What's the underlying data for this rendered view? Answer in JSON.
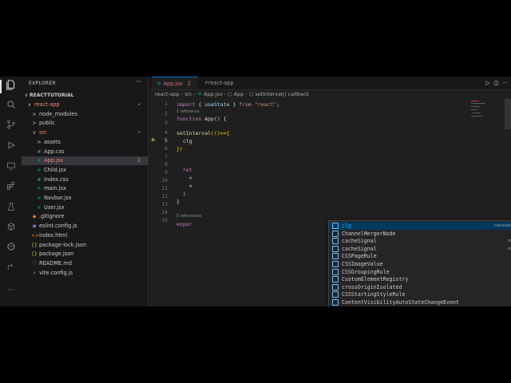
{
  "explorer": {
    "title": "EXPLORER",
    "more": "···",
    "project": "REACTTUTORIAL",
    "rows": [
      {
        "depth": 0,
        "chev": "∨",
        "label": "react-app",
        "badge": "•",
        "color": "#f48771"
      },
      {
        "depth": 1,
        "chev": ">",
        "label": "node_modules",
        "badge": "",
        "color": "#cccccc"
      },
      {
        "depth": 1,
        "chev": ">",
        "label": "public",
        "badge": "",
        "color": "#cccccc"
      },
      {
        "depth": 1,
        "chev": "∨",
        "label": "src",
        "badge": "•",
        "color": "#f48771"
      },
      {
        "depth": 2,
        "chev": ">",
        "label": "assets",
        "badge": "",
        "color": "#cccccc"
      },
      {
        "depth": 2,
        "icon": "#",
        "iconColor": "#519aba",
        "label": "App.css",
        "badge": "",
        "color": "#cccccc"
      },
      {
        "depth": 2,
        "icon": "⚛",
        "iconColor": "#00bcd4",
        "label": "App.jsx",
        "badge": "2",
        "color": "#f48771",
        "selected": true
      },
      {
        "depth": 2,
        "icon": "⚛",
        "iconColor": "#00bcd4",
        "label": "Child.jsx",
        "badge": "",
        "color": "#cccccc"
      },
      {
        "depth": 2,
        "icon": "#",
        "iconColor": "#519aba",
        "label": "index.css",
        "badge": "",
        "color": "#cccccc"
      },
      {
        "depth": 2,
        "icon": "⚛",
        "iconColor": "#00bcd4",
        "label": "main.jsx",
        "badge": "",
        "color": "#cccccc"
      },
      {
        "depth": 2,
        "icon": "⚛",
        "iconColor": "#00bcd4",
        "label": "Navbar.jsx",
        "badge": "",
        "color": "#cccccc"
      },
      {
        "depth": 2,
        "icon": "⚛",
        "iconColor": "#00bcd4",
        "label": "User.jsx",
        "badge": "",
        "color": "#cccccc"
      },
      {
        "depth": 1,
        "icon": "◆",
        "iconColor": "#e37933",
        "label": ".gitignore",
        "badge": "",
        "color": "#cccccc"
      },
      {
        "depth": 1,
        "icon": "◉",
        "iconColor": "#8080f2",
        "label": "eslint.config.js",
        "badge": "",
        "color": "#cccccc"
      },
      {
        "depth": 1,
        "icon": "<>",
        "iconColor": "#e37933",
        "label": "index.html",
        "badge": "",
        "color": "#cccccc"
      },
      {
        "depth": 1,
        "icon": "{}",
        "iconColor": "#cbcb41",
        "label": "package-lock.json",
        "badge": "",
        "color": "#cccccc"
      },
      {
        "depth": 1,
        "icon": "{}",
        "iconColor": "#cbcb41",
        "label": "package.json",
        "badge": "",
        "color": "#cccccc"
      },
      {
        "depth": 1,
        "icon": "ⓘ",
        "iconColor": "#519aba",
        "label": "README.md",
        "badge": "",
        "color": "#cccccc"
      },
      {
        "depth": 1,
        "icon": "⚡",
        "iconColor": "#bd93f9",
        "label": "vite.config.js",
        "badge": "",
        "color": "#cccccc"
      }
    ]
  },
  "tabs": [
    {
      "label": "App.jsx",
      "badge": "2",
      "active": true
    },
    {
      "label": "react-app",
      "active": false
    }
  ],
  "breadcrumb": [
    "react-app",
    "src",
    "App.jsx",
    "App",
    "setInterval() callback"
  ],
  "editor": {
    "line_numbers": [
      "1",
      "2",
      "3",
      "4",
      "5",
      "6",
      "7",
      "8",
      "9",
      "10",
      "11",
      "12",
      "13",
      "14",
      "15"
    ],
    "current_line": "5",
    "code_lens": "1 reference",
    "code_lens2": "0 references",
    "lines": [
      [
        {
          "t": "import",
          "c": "kw"
        },
        {
          "t": " { "
        },
        {
          "t": "useState",
          "c": "var"
        },
        {
          "t": " } "
        },
        {
          "t": "from",
          "c": "kw"
        },
        {
          "t": " "
        },
        {
          "t": "\"react\"",
          "c": "str"
        },
        {
          "t": ";"
        }
      ],
      [
        {
          "t": "function",
          "c": "kw"
        },
        {
          "t": " "
        },
        {
          "t": "App",
          "c": "fn"
        },
        {
          "t": "() {"
        }
      ],
      [],
      [
        {
          "t": "setInterval",
          "c": "fn"
        },
        {
          "t": "(()=>{",
          "c": "pn"
        }
      ],
      [
        {
          "t": "  clg"
        }
      ],
      [
        {
          "t": "})",
          "c": "pn"
        }
      ],
      [],
      [
        {
          "t": "  ret",
          "c": "kw"
        }
      ],
      [
        {
          "t": "    <"
        }
      ],
      [
        {
          "t": "    <"
        }
      ],
      [
        {
          "t": "  )"
        }
      ],
      [
        {
          "t": "}"
        }
      ],
      [],
      [
        {
          "t": "expor",
          "c": "kw"
        }
      ]
    ]
  },
  "suggestions": [
    {
      "label": "clg",
      "detail": "consoleLog",
      "match": "clg"
    },
    {
      "label": "ChannelMergerNode",
      "detail": "",
      "match": ""
    },
    {
      "label": "cacheSignal",
      "detail": "react",
      "match": ""
    },
    {
      "label": "cacheSignal",
      "detail": "react",
      "match": ""
    },
    {
      "label": "CSSPageRule",
      "detail": "",
      "match": ""
    },
    {
      "label": "CSSImageValue",
      "detail": "",
      "match": ""
    },
    {
      "label": "CSSGroupingRule",
      "detail": "",
      "match": ""
    },
    {
      "label": "CustomElementRegistry",
      "detail": "",
      "match": ""
    },
    {
      "label": "crossOriginIsolated",
      "detail": "",
      "match": ""
    },
    {
      "label": "CSSStartingStyleRule",
      "detail": "",
      "match": ""
    },
    {
      "label": "ContentVisibilityAutoStateChangeEvent",
      "detail": "",
      "match": ""
    }
  ],
  "colors": {
    "accent": "#0078d4",
    "error": "#f48771",
    "suggest_sel": "#04395e"
  }
}
